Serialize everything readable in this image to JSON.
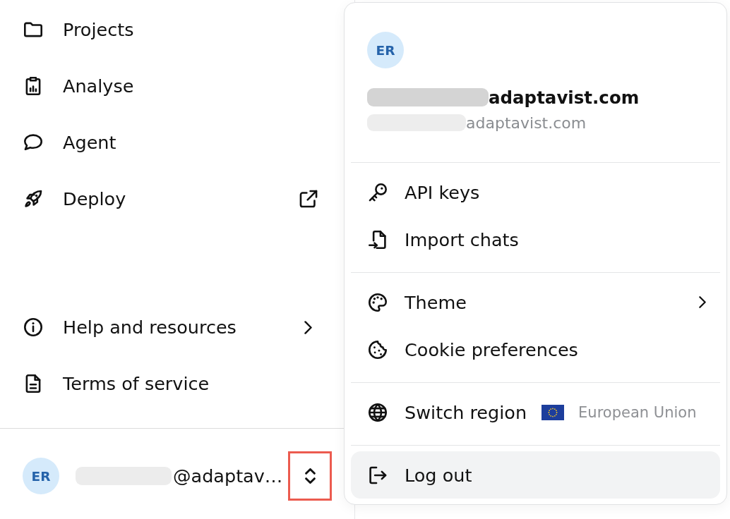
{
  "sidebar": {
    "nav_items": [
      {
        "label": "Projects",
        "kind": "page"
      },
      {
        "label": "Analyse",
        "kind": "page"
      },
      {
        "label": "Agent",
        "kind": "page"
      },
      {
        "label": "Deploy",
        "kind": "external"
      }
    ],
    "footer_items": [
      {
        "label": "Help and resources",
        "kind": "submenu"
      },
      {
        "label": "Terms of service",
        "kind": "page"
      }
    ],
    "account": {
      "initials": "ER",
      "email_redacted": true,
      "email": "@adaptav…",
      "switcher_highlighted": true
    }
  },
  "account_menu": {
    "initials": "ER",
    "name_redacted": true,
    "name": "adaptavist.com",
    "email_redacted": true,
    "email": "adaptavist.com",
    "groups": [
      {
        "items": [
          {
            "label": "API keys",
            "kind": "action",
            "hovered": false
          },
          {
            "label": "Import chats",
            "kind": "action",
            "hovered": false
          }
        ]
      },
      {
        "items": [
          {
            "label": "Theme",
            "kind": "submenu",
            "hovered": false
          },
          {
            "label": "Cookie preferences",
            "kind": "action",
            "hovered": false
          }
        ]
      },
      {
        "items": [
          {
            "label": "Switch region",
            "kind": "region",
            "value": "European Union",
            "hovered": false
          }
        ]
      },
      {
        "items": [
          {
            "label": "Log out",
            "kind": "action",
            "hovered": true
          }
        ]
      }
    ]
  }
}
